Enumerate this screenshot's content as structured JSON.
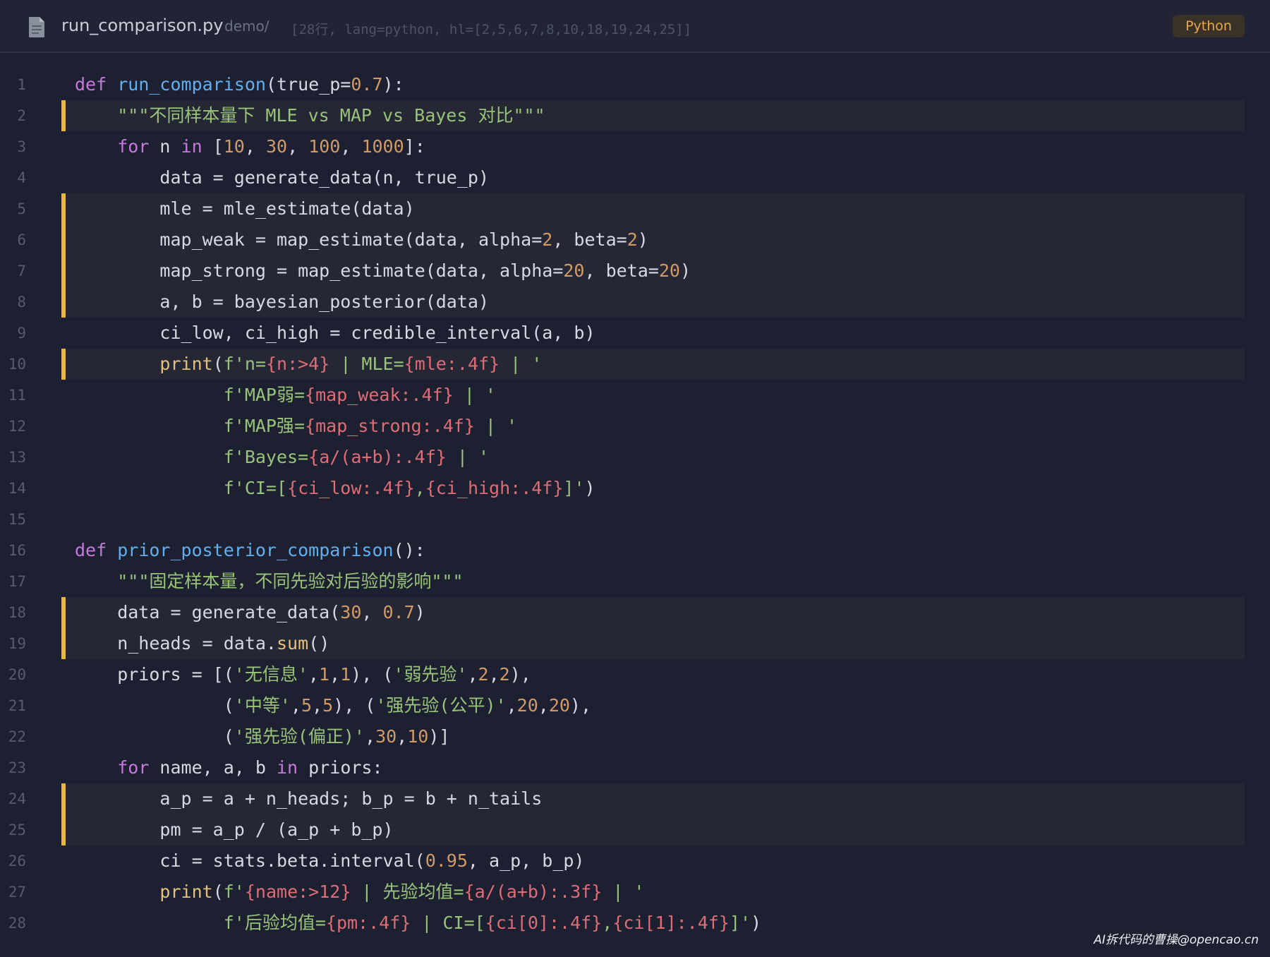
{
  "header": {
    "icon": "document-icon",
    "filename": "run_comparison.py",
    "dir": "demo/",
    "meta": "[28行, lang=python, hl=[2,5,6,7,8,10,18,19,24,25]]",
    "language": "Python"
  },
  "colors": {
    "keyword": "#c778dd",
    "function": "#61afef",
    "number": "#d19a66",
    "string": "#98c379",
    "interpolation": "#e06c75",
    "builtin": "#e5c07b",
    "highlight_bar": "#e8b53e"
  },
  "highlighted_lines": [
    2,
    5,
    6,
    7,
    8,
    10,
    18,
    19,
    24,
    25
  ],
  "code": [
    {
      "n": "1",
      "t": "def run_comparison(true_p=0.7):"
    },
    {
      "n": "2",
      "t": "    \"\"\"不同样本量下 MLE vs MAP vs Bayes 对比\"\"\""
    },
    {
      "n": "3",
      "t": "    for n in [10, 30, 100, 1000]:"
    },
    {
      "n": "4",
      "t": "        data = generate_data(n, true_p)"
    },
    {
      "n": "5",
      "t": "        mle = mle_estimate(data)"
    },
    {
      "n": "6",
      "t": "        map_weak = map_estimate(data, alpha=2, beta=2)"
    },
    {
      "n": "7",
      "t": "        map_strong = map_estimate(data, alpha=20, beta=20)"
    },
    {
      "n": "8",
      "t": "        a, b = bayesian_posterior(data)"
    },
    {
      "n": "9",
      "t": "        ci_low, ci_high = credible_interval(a, b)"
    },
    {
      "n": "10",
      "t": "        print(f'n={n:>4} | MLE={mle:.4f} | '"
    },
    {
      "n": "11",
      "t": "              f'MAP弱={map_weak:.4f} | '"
    },
    {
      "n": "12",
      "t": "              f'MAP强={map_strong:.4f} | '"
    },
    {
      "n": "13",
      "t": "              f'Bayes={a/(a+b):.4f} | '"
    },
    {
      "n": "14",
      "t": "              f'CI=[{ci_low:.4f},{ci_high:.4f}]')"
    },
    {
      "n": "15",
      "t": ""
    },
    {
      "n": "16",
      "t": "def prior_posterior_comparison():"
    },
    {
      "n": "17",
      "t": "    \"\"\"固定样本量，不同先验对后验的影响\"\"\""
    },
    {
      "n": "18",
      "t": "    data = generate_data(30, 0.7)"
    },
    {
      "n": "19",
      "t": "    n_heads = data.sum()"
    },
    {
      "n": "20",
      "t": "    priors = [('无信息',1,1), ('弱先验',2,2),"
    },
    {
      "n": "21",
      "t": "              ('中等',5,5), ('强先验(公平)',20,20),"
    },
    {
      "n": "22",
      "t": "              ('强先验(偏正)',30,10)]"
    },
    {
      "n": "23",
      "t": "    for name, a, b in priors:"
    },
    {
      "n": "24",
      "t": "        a_p = a + n_heads; b_p = b + n_tails"
    },
    {
      "n": "25",
      "t": "        pm = a_p / (a_p + b_p)"
    },
    {
      "n": "26",
      "t": "        ci = stats.beta.interval(0.95, a_p, b_p)"
    },
    {
      "n": "27",
      "t": "        print(f'{name:>12} | 先验均值={a/(a+b):.3f} | '"
    },
    {
      "n": "28",
      "t": "              f'后验均值={pm:.4f} | CI=[{ci[0]:.4f},{ci[1]:.4f}]')"
    }
  ],
  "watermark": "AI拆代码的曹操@opencao.cn"
}
